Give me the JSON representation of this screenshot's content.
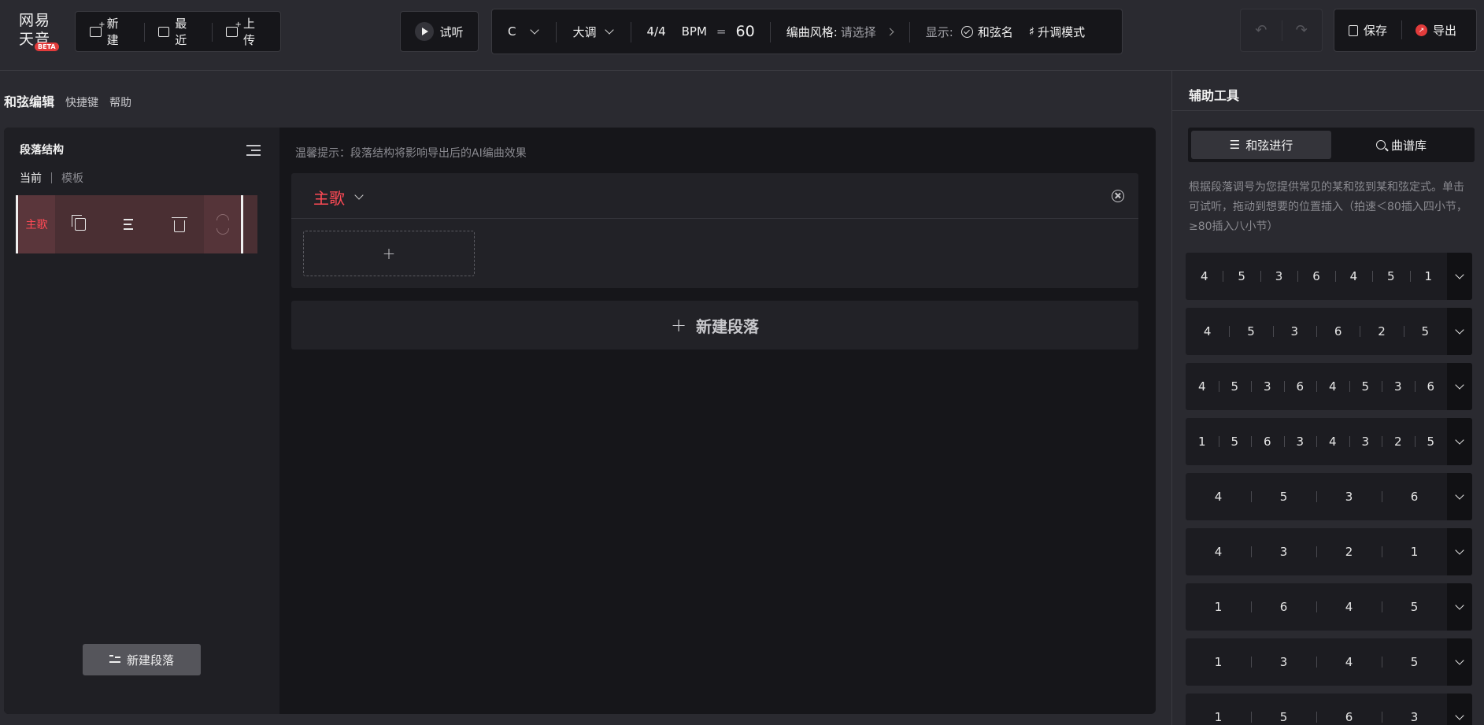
{
  "logo": {
    "line1": "网易",
    "line2": "天音",
    "badge": "BETA"
  },
  "file_menu": {
    "new": "新建",
    "recent": "最近",
    "upload": "上传"
  },
  "preview": {
    "label": "试听"
  },
  "settings": {
    "key": "C",
    "mode": "大调",
    "time_signature": "4/4",
    "bpm_label": "BPM",
    "bpm_eq": "=",
    "bpm_value": "60",
    "style_label": "编曲风格:",
    "style_value": "请选择",
    "display_label": "显示:",
    "chord_name": "和弦名",
    "transpose_mode": "升调模式"
  },
  "history": {
    "undo": "↶",
    "redo": "↷"
  },
  "actions": {
    "save": "保存",
    "export": "导出"
  },
  "editor": {
    "title": "和弦编辑",
    "shortcut": "快捷键",
    "help": "帮助"
  },
  "structure": {
    "title": "段落结构",
    "tab_current": "当前",
    "tab_template": "模板",
    "segments": [
      {
        "name": "主歌"
      }
    ],
    "new_segment": "新建段落"
  },
  "workspace": {
    "hint": "温馨提示：段落结构将影响导出后的AI编曲效果",
    "segment_name": "主歌",
    "add_symbol": "+",
    "new_segment": "新建段落"
  },
  "assist": {
    "title": "辅助工具",
    "tab_progression": "和弦进行",
    "tab_library": "曲谱库",
    "description": "根据段落调号为您提供常见的某和弦到某和弦定式。单击可试听，拖动到想要的位置插入（拍速＜80插入四小节，≥80插入八小节）",
    "progressions": [
      [
        "4",
        "5",
        "3",
        "6",
        "4",
        "5",
        "1"
      ],
      [
        "4",
        "5",
        "3",
        "6",
        "2",
        "5"
      ],
      [
        "4",
        "5",
        "3",
        "6",
        "4",
        "5",
        "3",
        "6"
      ],
      [
        "1",
        "5",
        "6",
        "3",
        "4",
        "3",
        "2",
        "5"
      ],
      [
        "4",
        "5",
        "3",
        "6"
      ],
      [
        "4",
        "3",
        "2",
        "1"
      ],
      [
        "1",
        "6",
        "4",
        "5"
      ],
      [
        "1",
        "3",
        "4",
        "5"
      ],
      [
        "1",
        "5",
        "6",
        "3"
      ]
    ]
  },
  "colors": {
    "accent": "#ff4a55",
    "panel": "#16161a",
    "bg": "#2a2a30"
  }
}
